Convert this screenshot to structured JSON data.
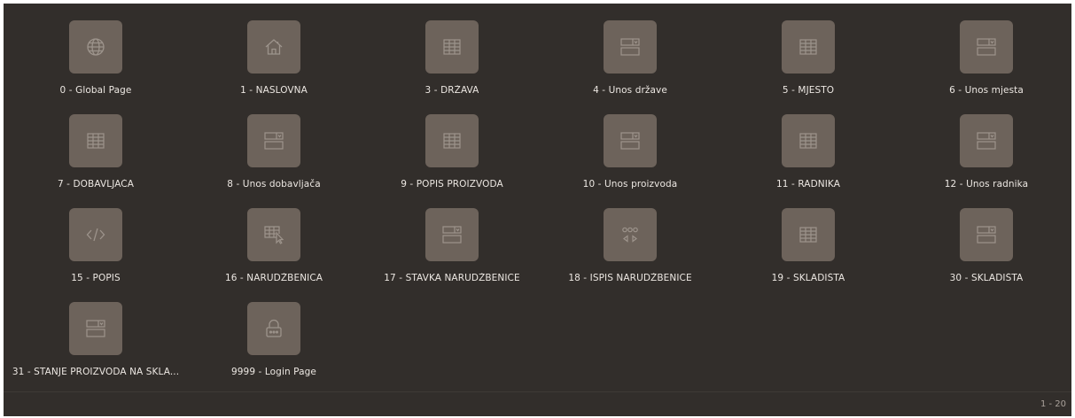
{
  "pages": [
    {
      "label": "0 - Global Page",
      "icon": "globe-icon"
    },
    {
      "label": "1 - NASLOVNA",
      "icon": "home-icon"
    },
    {
      "label": "3 - DRŽAVA",
      "icon": "table-grid-icon"
    },
    {
      "label": "4 - Unos države",
      "icon": "form-icon"
    },
    {
      "label": "5 - MJESTO",
      "icon": "table-grid-icon"
    },
    {
      "label": "6 - Unos mjesta",
      "icon": "form-icon"
    },
    {
      "label": "7 - DOBAVLJAČA",
      "icon": "table-grid-icon"
    },
    {
      "label": "8 - Unos dobavljača",
      "icon": "form-icon"
    },
    {
      "label": "9 - POPIS PROIZVODA",
      "icon": "table-grid-icon"
    },
    {
      "label": "10 - Unos proizvoda",
      "icon": "form-icon"
    },
    {
      "label": "11 - RADNIKA",
      "icon": "table-grid-icon"
    },
    {
      "label": "12 - Unos radnika",
      "icon": "form-icon"
    },
    {
      "label": "15 - POPIS",
      "icon": "code-icon"
    },
    {
      "label": "16 - NARUDŽBENICA",
      "icon": "interactive-grid-icon"
    },
    {
      "label": "17 - STAVKA NARUDŽBENICE",
      "icon": "form-icon"
    },
    {
      "label": "18 - ISPIS NARUDŽBENICE",
      "icon": "carousel-icon"
    },
    {
      "label": "19 - SKLADIŠTA",
      "icon": "table-grid-icon"
    },
    {
      "label": "30 - SKLADIŠTA",
      "icon": "form-icon"
    },
    {
      "label": "31 - STANJE PROIZVODA NA SKLA...",
      "icon": "form-icon"
    },
    {
      "label": "9999 - Login Page",
      "icon": "lock-icon"
    }
  ],
  "pagination": {
    "range": "1 - 20"
  },
  "colors": {
    "background": "#322e2b",
    "tile": "#6d635b",
    "icon_stroke": "#9d948c",
    "label": "#ece7e2"
  }
}
